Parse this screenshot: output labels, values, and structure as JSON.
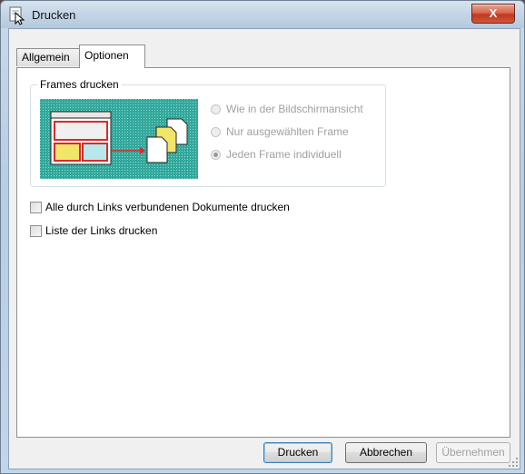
{
  "window": {
    "title": "Drucken",
    "close_label": "X"
  },
  "tabs": [
    {
      "label": "Allgemein"
    },
    {
      "label": "Optionen"
    }
  ],
  "frames_group": {
    "legend": "Frames drucken",
    "options": [
      {
        "label": "Wie in der Bildschirmansicht",
        "checked": false
      },
      {
        "label": "Nur ausgewählten Frame",
        "checked": false
      },
      {
        "label": "Jeden Frame individuell",
        "checked": true
      }
    ]
  },
  "checkboxes": [
    {
      "label": "Alle durch Links verbundenen Dokumente drucken",
      "checked": false
    },
    {
      "label": "Liste der Links drucken",
      "checked": false
    }
  ],
  "buttons": {
    "print": "Drucken",
    "cancel": "Abbrechen",
    "apply": "Übernehmen"
  },
  "colors": {
    "illustration_background": "#33a89c",
    "frame_highlight": "#f3e46a",
    "arrow": "#d62b2b"
  }
}
